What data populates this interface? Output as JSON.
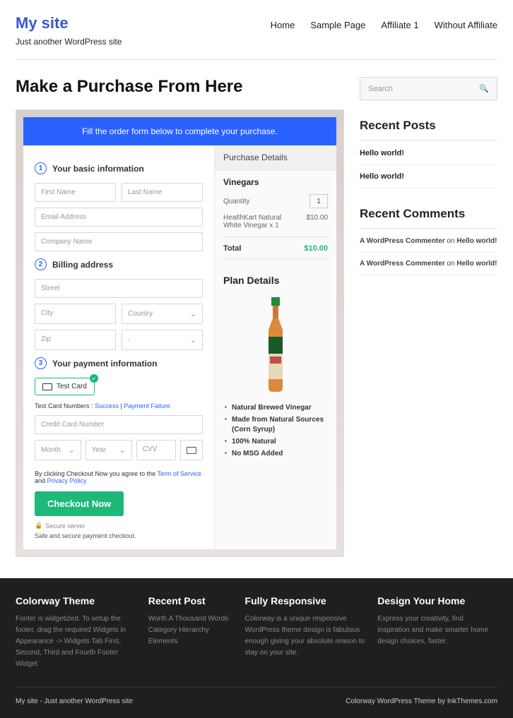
{
  "site": {
    "title": "My site",
    "tagline": "Just another WordPress site"
  },
  "nav": [
    "Home",
    "Sample Page",
    "Affiliate 1",
    "Without Affiliate"
  ],
  "page": {
    "title": "Make a Purchase From Here"
  },
  "banner": "Fill the order form below to complete your purchase.",
  "sections": {
    "s1": {
      "num": "1",
      "label": "Your basic information"
    },
    "s2": {
      "num": "2",
      "label": "Billing address"
    },
    "s3": {
      "num": "3",
      "label": "Your payment information"
    }
  },
  "placeholders": {
    "first": "First Name",
    "last": "Last Name",
    "email": "Email Address",
    "company": "Company Name",
    "street": "Street",
    "city": "City",
    "country": "Country",
    "zip": "Zip",
    "dash": "-",
    "cc": "Credit Card Number",
    "month": "Month",
    "year": "Year",
    "cvv": "CVV"
  },
  "testcard": {
    "label": "Test Card",
    "hint_pre": "Test Card Numbers : ",
    "hint_s": "Success",
    "hint_sep": " | ",
    "hint_f": "Payment Failure"
  },
  "terms": {
    "pre": "By clicking Checkout Now you agree to the ",
    "tos": "Term of Service",
    "and": " and ",
    "pp": "Privacy Policy"
  },
  "checkout": {
    "btn": "Checkout Now",
    "secure": "Secure server",
    "safe": "Safe and secure payment checkout."
  },
  "purchase": {
    "heading": "Purchase Details",
    "sub": "Vinegars",
    "qty_label": "Quantity",
    "qty": "1",
    "item": "HealthKart Natural White Vinegar x 1",
    "item_price": "$10.00",
    "total_label": "Total",
    "total": "$10.00"
  },
  "plan": {
    "title": "Plan Details",
    "bullets": [
      "Natural Brewed Vinegar",
      "Made from Natural Sources (Corn Syrup)",
      "100% Natural",
      "No MSG Added"
    ]
  },
  "sidebar": {
    "search": "Search",
    "recent_h": "Recent Posts",
    "recent": [
      "Hello world!",
      "Hello world!"
    ],
    "comments_h": "Recent Comments",
    "comments": [
      {
        "author": "A WordPress Commenter",
        "on": " on ",
        "post": "Hello world!"
      },
      {
        "author": "A WordPress Commenter",
        "on": " on ",
        "post": "Hello world!"
      }
    ]
  },
  "footer": {
    "cols": [
      {
        "h": "Colorway Theme",
        "t": "Footer is widgetized. To setup the footer, drag the required Widgets in Appearance -> Widgets Tab First, Second, Third and Fourth Footer Widget"
      },
      {
        "h": "Recent Post",
        "lines": [
          "Worth A Thousand Words",
          "Category Hierarchy",
          "Elements"
        ]
      },
      {
        "h": "Fully Responsive",
        "t": "Colorway is a unique responsive WordPress theme design is fabulous enough giving your absolute reason to stay on your site."
      },
      {
        "h": "Design Your Home",
        "t": "Express your creativity, find inspiration and make smarter home design choices, faster."
      }
    ],
    "left": "My site - Just another WordPress site",
    "right": "Colorway WordPress Theme by InkThemes.com"
  }
}
